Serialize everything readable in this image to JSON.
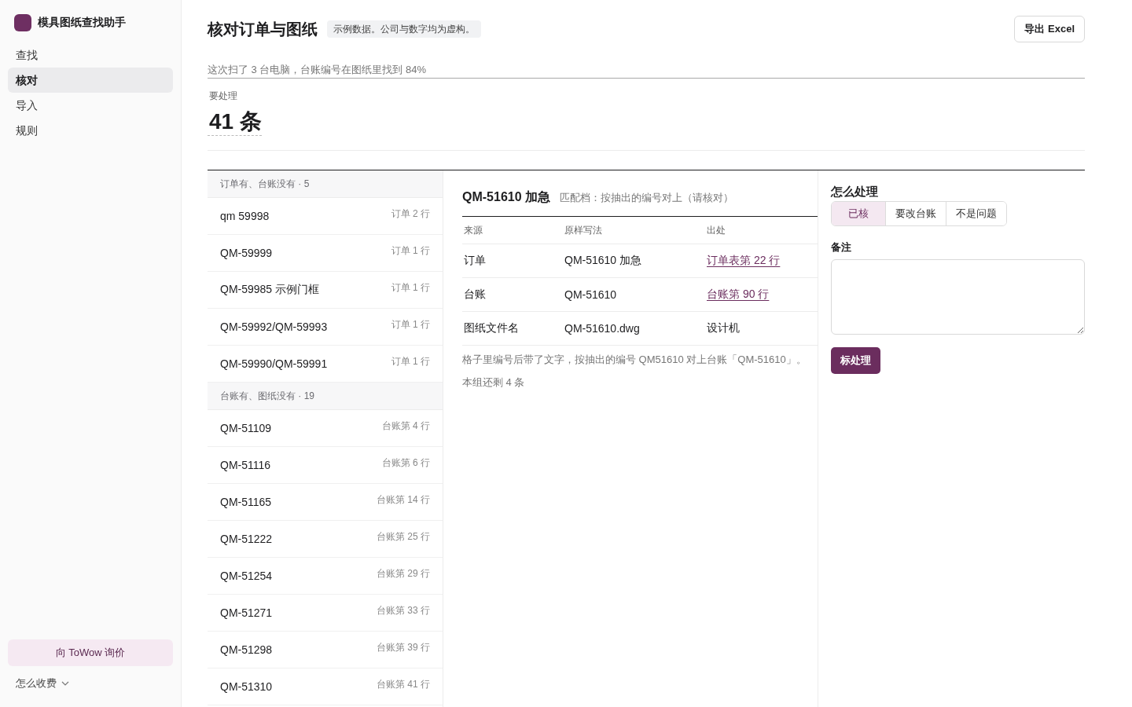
{
  "sidebar": {
    "app_name": "模具图纸查找助手",
    "nav": [
      {
        "label": "查找",
        "selected": false
      },
      {
        "label": "核对",
        "selected": true
      },
      {
        "label": "导入",
        "selected": false
      },
      {
        "label": "规则",
        "selected": false
      }
    ],
    "quote_button": "向 ToWow 询价",
    "pricing": {
      "label": "怎么收费",
      "expanded": false
    }
  },
  "header": {
    "title": "核对订单与图纸",
    "badge": "示例数据。公司与数字均为虚构。",
    "export_button": "导出 Excel"
  },
  "summary": {
    "text": "这次扫了 3 台电脑，台账编号在图纸里找到 84%",
    "pending_label": "要处理",
    "pending_count": "41 条"
  },
  "issue_list": {
    "groups": [
      {
        "title": "订单有、台账没有 · 5",
        "items": [
          {
            "code": "qm 59998",
            "location": "订单 2 行",
            "selected": false
          },
          {
            "code": "QM-59999",
            "location": "订单 1 行",
            "selected": false
          },
          {
            "code": "QM-59985 示例门框",
            "location": "订单 1 行",
            "selected": false
          },
          {
            "code": "QM-59992/QM-59993",
            "location": "订单 1 行",
            "selected": false
          },
          {
            "code": "QM-59990/QM-59991",
            "location": "订单 1 行",
            "selected": false
          }
        ]
      },
      {
        "title": "台账有、图纸没有 · 19",
        "items": [
          {
            "code": "QM-51109",
            "location": "台账第 4 行",
            "selected": false
          },
          {
            "code": "QM-51116",
            "location": "台账第 6 行",
            "selected": false
          },
          {
            "code": "QM-51165",
            "location": "台账第 14 行",
            "selected": false
          },
          {
            "code": "QM-51222",
            "location": "台账第 25 行",
            "selected": false
          },
          {
            "code": "QM-51254",
            "location": "台账第 29 行",
            "selected": false
          },
          {
            "code": "QM-51271",
            "location": "台账第 33 行",
            "selected": false
          },
          {
            "code": "QM-51298",
            "location": "台账第 39 行",
            "selected": false
          },
          {
            "code": "QM-51310",
            "location": "台账第 41 行",
            "selected": false
          }
        ]
      }
    ]
  },
  "detail": {
    "title": "QM-51610 加急",
    "match_note": "匹配档：按抽出的编号对上（请核对）",
    "columns": [
      "来源",
      "原样写法",
      "出处"
    ],
    "rows": [
      {
        "source": "订单",
        "raw": "QM-51610 加急",
        "origin": {
          "text": "订单表第 22 行",
          "kind": "link"
        }
      },
      {
        "source": "台账",
        "raw": "QM-51610",
        "origin": {
          "text": "台账第 90 行",
          "kind": "link"
        }
      },
      {
        "source": "图纸文件名",
        "raw": "QM-51610.dwg",
        "origin": {
          "text": "设计机",
          "kind": "text"
        }
      }
    ],
    "explanation": "格子里编号后带了文字，按抽出的编号 QM51610 对上台账「QM-51610」。",
    "remaining": "本组还剩 4 条"
  },
  "action": {
    "title": "怎么处理",
    "options": [
      {
        "label": "已核",
        "selected": true
      },
      {
        "label": "要改台账",
        "selected": false
      },
      {
        "label": "不是问题",
        "selected": false
      }
    ],
    "note_label": "备注",
    "submit_button": "标处理"
  }
}
